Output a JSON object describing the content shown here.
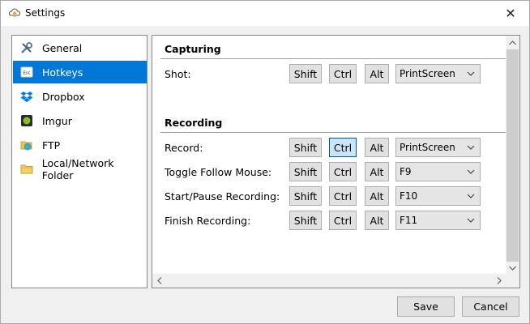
{
  "window": {
    "title": "Settings",
    "app_icon": "cloud-upload-icon",
    "close_icon": "close-icon"
  },
  "sidebar": {
    "items": [
      {
        "label": "General",
        "icon": "tools-icon",
        "selected": false
      },
      {
        "label": "Hotkeys",
        "icon": "keyboard-esc-icon",
        "selected": true
      },
      {
        "label": "Dropbox",
        "icon": "dropbox-icon",
        "selected": false
      },
      {
        "label": "Imgur",
        "icon": "imgur-icon",
        "selected": false
      },
      {
        "label": "FTP",
        "icon": "ftp-globe-icon",
        "selected": false
      },
      {
        "label": "Local/Network Folder",
        "icon": "folder-icon",
        "selected": false
      }
    ]
  },
  "capturing": {
    "title": "Capturing",
    "rows": [
      {
        "label": "Shot:",
        "shift": "Shift",
        "ctrl": "Ctrl",
        "alt": "Alt",
        "key": "PrintScreen",
        "ctrl_pressed": false
      }
    ]
  },
  "recording": {
    "title": "Recording",
    "rows": [
      {
        "label": "Record:",
        "shift": "Shift",
        "ctrl": "Ctrl",
        "alt": "Alt",
        "key": "PrintScreen",
        "ctrl_pressed": true
      },
      {
        "label": "Toggle Follow Mouse:",
        "shift": "Shift",
        "ctrl": "Ctrl",
        "alt": "Alt",
        "key": "F9",
        "ctrl_pressed": false
      },
      {
        "label": "Start/Pause Recording:",
        "shift": "Shift",
        "ctrl": "Ctrl",
        "alt": "Alt",
        "key": "F10",
        "ctrl_pressed": false
      },
      {
        "label": "Finish Recording:",
        "shift": "Shift",
        "ctrl": "Ctrl",
        "alt": "Alt",
        "key": "F11",
        "ctrl_pressed": false
      }
    ]
  },
  "footer": {
    "save_label": "Save",
    "cancel_label": "Cancel"
  },
  "colors": {
    "selection": "#0078d7",
    "pressed_border": "#005499",
    "pressed_bg": "#cce4f7"
  }
}
